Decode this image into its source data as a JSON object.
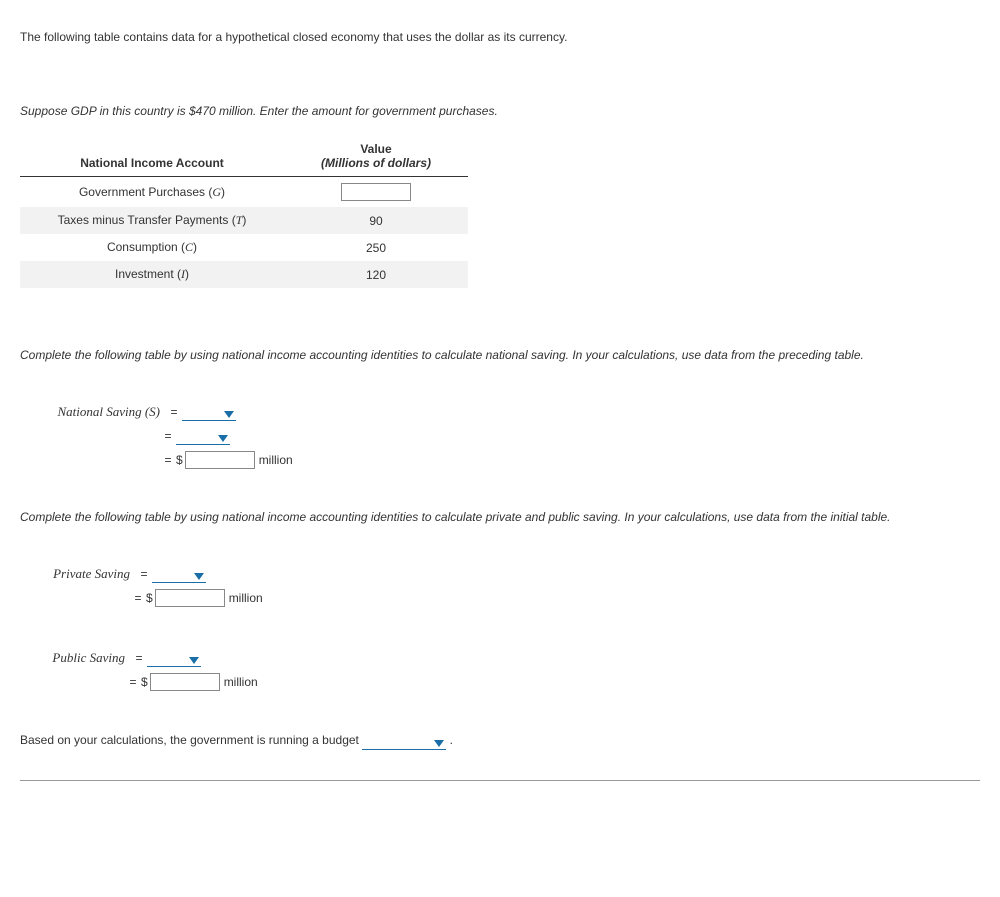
{
  "intro": "The following table contains data for a hypothetical closed economy that uses the dollar as its currency.",
  "instruction1": "Suppose GDP in this country is $470 million. Enter the amount for government purchases.",
  "table": {
    "header_left": "National Income Account",
    "header_right_top": "Value",
    "header_right_sub": "(Millions of dollars)",
    "rows": [
      {
        "label": "Government Purchases (G)",
        "value": ""
      },
      {
        "label": "Taxes minus Transfer Payments (T)",
        "value": "90"
      },
      {
        "label": "Consumption (C)",
        "value": "250"
      },
      {
        "label": "Investment (I)",
        "value": "120"
      }
    ]
  },
  "instruction2": "Complete the following table by using national income accounting identities to calculate national saving. In your calculations, use data from the preceding table.",
  "national_saving": {
    "label": "National Saving (S)",
    "eq": "=",
    "dollar": "$",
    "unit": "million"
  },
  "instruction3": "Complete the following table by using national income accounting identities to calculate private and public saving. In your calculations, use data from the initial table.",
  "private_saving": {
    "label": "Private Saving",
    "eq": "=",
    "dollar": "$",
    "unit": "million"
  },
  "public_saving": {
    "label": "Public Saving",
    "eq": "=",
    "dollar": "$",
    "unit": "million"
  },
  "final": {
    "prefix": "Based on your calculations, the government is running a budget ",
    "suffix": "."
  }
}
